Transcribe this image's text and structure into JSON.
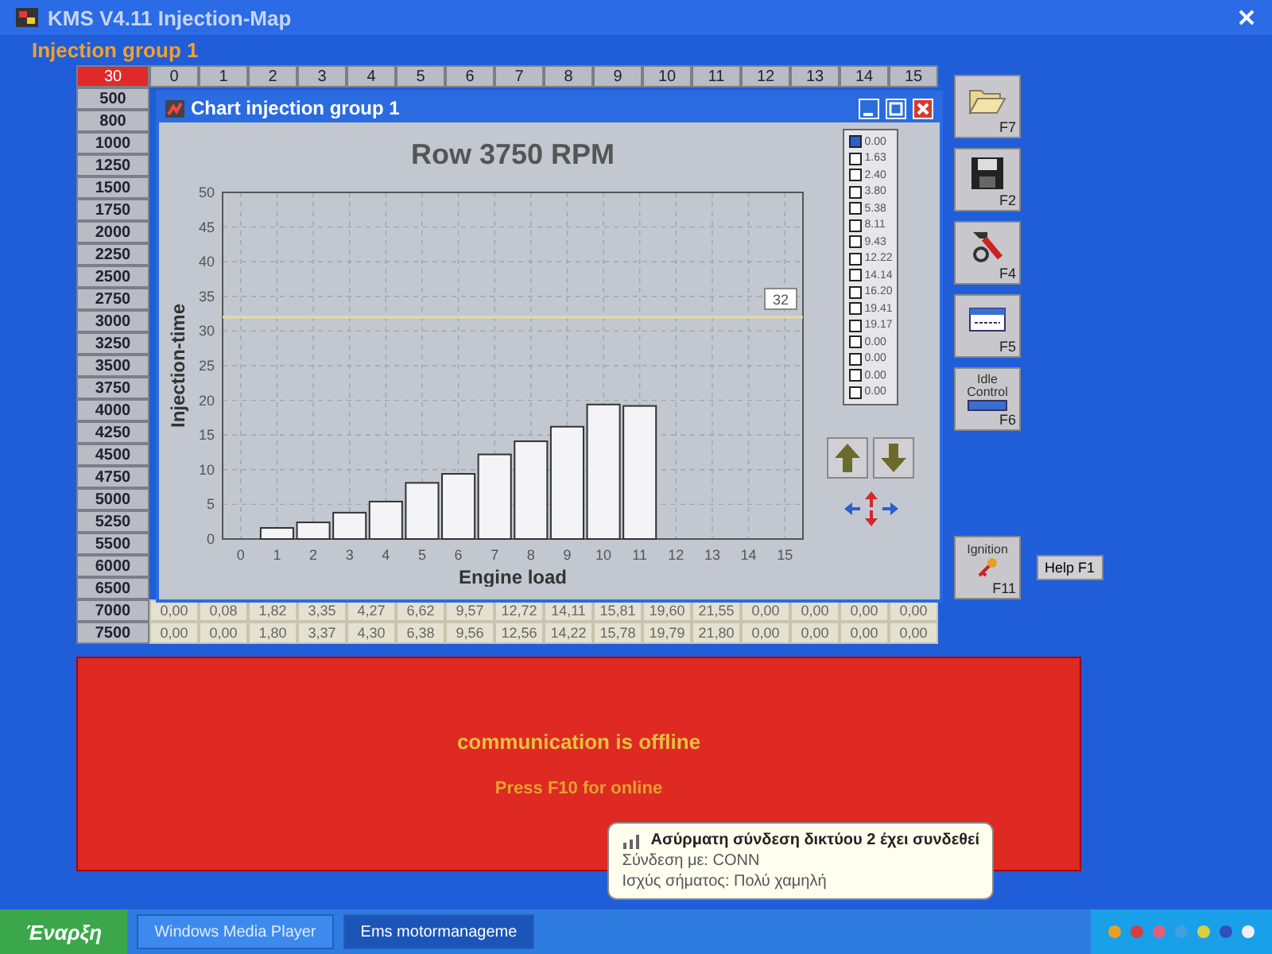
{
  "window": {
    "title": "KMS V4.11 Injection-Map",
    "subtitle": "Injection group 1"
  },
  "table": {
    "corner": "30",
    "columns": [
      "0",
      "1",
      "2",
      "3",
      "4",
      "5",
      "6",
      "7",
      "8",
      "9",
      "10",
      "11",
      "12",
      "13",
      "14",
      "15"
    ],
    "rows": [
      {
        "label": "500"
      },
      {
        "label": "800"
      },
      {
        "label": "1000"
      },
      {
        "label": "1250"
      },
      {
        "label": "1500"
      },
      {
        "label": "1750"
      },
      {
        "label": "2000"
      },
      {
        "label": "2250"
      },
      {
        "label": "2500"
      },
      {
        "label": "2750"
      },
      {
        "label": "3000"
      },
      {
        "label": "3250"
      },
      {
        "label": "3500"
      },
      {
        "label": "3750"
      },
      {
        "label": "4000"
      },
      {
        "label": "4250"
      },
      {
        "label": "4500"
      },
      {
        "label": "4750"
      },
      {
        "label": "5000"
      },
      {
        "label": "5250"
      },
      {
        "label": "5500"
      },
      {
        "label": "6000"
      },
      {
        "label": "6500"
      },
      {
        "label": "7000",
        "cells": [
          "0,00",
          "0,08",
          "1,82",
          "3,35",
          "4,27",
          "6,62",
          "9,57",
          "12,72",
          "14,11",
          "15,81",
          "19,60",
          "21,55",
          "0,00",
          "0,00",
          "0,00",
          "0,00"
        ]
      },
      {
        "label": "7500",
        "cells": [
          "0,00",
          "0,00",
          "1,80",
          "3,37",
          "4,30",
          "6,38",
          "9,56",
          "12,56",
          "14,22",
          "15,78",
          "19,79",
          "21,80",
          "0,00",
          "0,00",
          "0,00",
          "0,00"
        ]
      }
    ]
  },
  "chart_window": {
    "title": "Chart injection group 1",
    "chart_data": {
      "type": "bar",
      "title": "Row 3750 RPM",
      "xlabel": "Engine load",
      "ylabel": "Injection-time",
      "categories": [
        "0",
        "1",
        "2",
        "3",
        "4",
        "5",
        "6",
        "7",
        "8",
        "9",
        "10",
        "11",
        "12",
        "13",
        "14",
        "15"
      ],
      "values": [
        0,
        1.6,
        2.4,
        3.8,
        5.4,
        8.1,
        9.4,
        12.2,
        14.1,
        16.2,
        19.4,
        19.2,
        0,
        0,
        0,
        0
      ],
      "grid": true,
      "ylim": [
        0,
        50
      ],
      "yticks": [
        0,
        5,
        10,
        15,
        20,
        25,
        30,
        35,
        40,
        45,
        50
      ],
      "ref_lines": [
        {
          "axis": "y",
          "value": 32,
          "label": "32"
        }
      ]
    },
    "legend": [
      {
        "label": "0.00",
        "checked": true
      },
      {
        "label": "1.63",
        "checked": false
      },
      {
        "label": "2.40",
        "checked": false
      },
      {
        "label": "3.80",
        "checked": false
      },
      {
        "label": "5.38",
        "checked": false
      },
      {
        "label": "8.11",
        "checked": false
      },
      {
        "label": "9.43",
        "checked": false
      },
      {
        "label": "12.22",
        "checked": false
      },
      {
        "label": "14.14",
        "checked": false
      },
      {
        "label": "16.20",
        "checked": false
      },
      {
        "label": "19.41",
        "checked": false
      },
      {
        "label": "19.17",
        "checked": false
      },
      {
        "label": "0.00",
        "checked": false
      },
      {
        "label": "0.00",
        "checked": false
      },
      {
        "label": "0.00",
        "checked": false
      },
      {
        "label": "0.00",
        "checked": false
      }
    ]
  },
  "toolbar": [
    {
      "kind": "open",
      "key": "F7"
    },
    {
      "kind": "save",
      "key": "F2"
    },
    {
      "kind": "tools",
      "key": "F4"
    },
    {
      "kind": "window",
      "key": "F5"
    },
    {
      "kind": "idle",
      "key": "F6",
      "label": "Idle Control"
    }
  ],
  "ignition_button": {
    "label": "Ignition",
    "key": "F11"
  },
  "help_button": {
    "label": "Help F1"
  },
  "status_panel": {
    "message": "communication is offline",
    "hint": "Press F10 for online"
  },
  "balloon": {
    "title": "Ασύρματη σύνδεση δικτύου 2 έχει συνδεθεί",
    "lines": [
      "Σύνδεση με: CONN",
      "Ισχύς σήματος: Πολύ χαμηλή"
    ]
  },
  "taskbar": {
    "start": "Έναρξη",
    "tasks": [
      {
        "label": "Windows Media Player",
        "selected": false
      },
      {
        "label": "Ems motormanageme",
        "selected": true
      }
    ]
  }
}
